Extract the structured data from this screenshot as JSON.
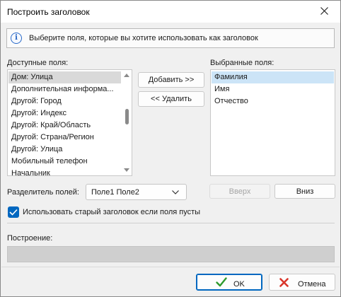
{
  "window": {
    "title": "Построить заголовок"
  },
  "info": {
    "text": "Выберите поля, которые вы хотите использовать как заголовок"
  },
  "available": {
    "label": "Доступные поля:",
    "items": [
      "Дом: Улица",
      "Дополнительная информа...",
      "Другой: Город",
      "Другой: Индекс",
      "Другой: Край/Область",
      "Другой: Страна/Регион",
      "Другой: Улица",
      "Мобильный телефон",
      "Начальник"
    ],
    "selected_index": 0
  },
  "selected": {
    "label": "Выбранные поля:",
    "items": [
      "Фамилия",
      "Имя",
      "Отчество"
    ],
    "selected_index": 0
  },
  "buttons": {
    "add": "Добавить >>",
    "remove": "<< Удалить",
    "up": "Вверх",
    "down": "Вниз",
    "ok": "OK",
    "cancel": "Отмена"
  },
  "separator": {
    "label": "Разделитель полей:",
    "value": "Поле1 Поле2"
  },
  "use_old": {
    "label": "Использовать старый заголовок если поля пусты",
    "checked": true
  },
  "build": {
    "label": "Построение:",
    "value": ""
  },
  "colors": {
    "accent": "#0067c0",
    "selection_blue": "#cce4f7",
    "selection_gray": "#d9d9d9",
    "ok_check": "#2e9a2e",
    "cancel_x": "#d9362b"
  },
  "icons": {
    "info": "info-icon",
    "close": "close-icon",
    "dropdown": "chevron-down-icon",
    "check": "checkmark-icon",
    "ok": "green-check-icon",
    "cancel": "red-x-icon"
  }
}
